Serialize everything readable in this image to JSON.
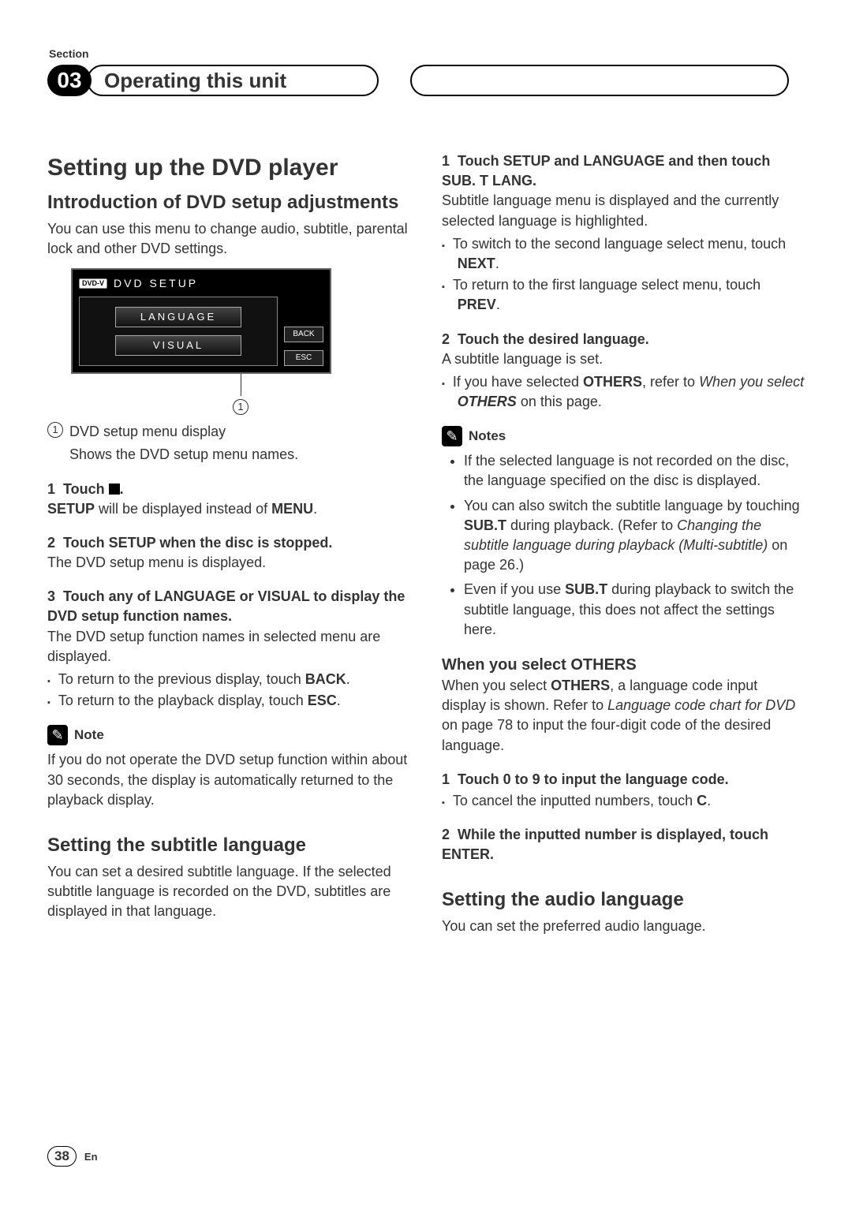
{
  "header": {
    "section_label": "Section",
    "section_number": "03",
    "title": "Operating this unit"
  },
  "left": {
    "h1": "Setting up the DVD player",
    "h2a": "Introduction of DVD setup adjustments",
    "intro": "You can use this menu to change audio, subtitle, parental lock and other DVD settings.",
    "fig": {
      "title": "DVD SETUP",
      "logo": "DVD-V",
      "btn_lang": "LANGUAGE",
      "btn_visual": "VISUAL",
      "btn_back": "BACK",
      "btn_esc": "ESC",
      "callout_num": "1"
    },
    "def_num": "1",
    "def_line1": "DVD setup menu display",
    "def_line2": "Shows the DVD setup menu names.",
    "step1_num": "1",
    "step1_pre": "Touch ",
    "step1_post": ".",
    "step1_body_a": "SETUP",
    "step1_body_b": " will be displayed instead of ",
    "step1_body_c": "MENU",
    "step1_body_d": ".",
    "step2_num": "2",
    "step2_title": "Touch SETUP when the disc is stopped.",
    "step2_body": "The DVD setup menu is displayed.",
    "step3_num": "3",
    "step3_title": "Touch any of LANGUAGE or VISUAL to display the DVD setup function names.",
    "step3_body": "The DVD setup function names in selected menu are displayed.",
    "step3_b1_a": "To return to the previous display, touch ",
    "step3_b1_b": "BACK",
    "step3_b1_c": ".",
    "step3_b2_a": "To return to the playback display, touch ",
    "step3_b2_b": "ESC",
    "step3_b2_c": ".",
    "note_label": "Note",
    "note_body": "If you do not operate the DVD setup function within about 30 seconds, the display is automatically returned to the playback display.",
    "h2b": "Setting the subtitle language",
    "h2b_body": "You can set a desired subtitle language. If the selected subtitle language is recorded on the DVD, subtitles are displayed in that language."
  },
  "right": {
    "r1_num": "1",
    "r1_title": "Touch SETUP and LANGUAGE and then touch SUB. T LANG.",
    "r1_body": "Subtitle language menu is displayed and the currently selected language is highlighted.",
    "r1_b1_a": "To switch to the second language select menu, touch ",
    "r1_b1_b": "NEXT",
    "r1_b1_c": ".",
    "r1_b2_a": "To return to the first language select menu, touch ",
    "r1_b2_b": "PREV",
    "r1_b2_c": ".",
    "r2_num": "2",
    "r2_title": "Touch the desired language.",
    "r2_body": "A subtitle language is set.",
    "r2_b1_a": "If you have selected ",
    "r2_b1_b": "OTHERS",
    "r2_b1_c": ", refer to ",
    "r2_b1_d": "When you select ",
    "r2_b1_e": "OTHERS",
    "r2_b1_f": " on this page.",
    "notes_label": "Notes",
    "note1": "If the selected language is not recorded on the disc, the language specified on the disc is displayed.",
    "note2_a": "You can also switch the subtitle language by touching ",
    "note2_b": "SUB.T",
    "note2_c": " during playback. (Refer to ",
    "note2_d": "Changing the subtitle language during playback (Multi-subtitle)",
    "note2_e": " on page 26.)",
    "note3_a": "Even if you use ",
    "note3_b": "SUB.T",
    "note3_c": " during playback to switch the subtitle language, this does not affect the settings here.",
    "h3_others": "When you select OTHERS",
    "others_a": "When you select ",
    "others_b": "OTHERS",
    "others_c": ", a language code input display is shown. Refer to ",
    "others_d": "Language code chart for DVD",
    "others_e": " on page 78 to input the four-digit code of the desired language.",
    "o1_num": "1",
    "o1_title": "Touch 0 to 9 to input the language code.",
    "o1_b1_a": "To cancel the inputted numbers, touch ",
    "o1_b1_b": "C",
    "o1_b1_c": ".",
    "o2_num": "2",
    "o2_title": "While the inputted number is displayed, touch ENTER.",
    "h2_audio": "Setting the audio language",
    "audio_body": "You can set the preferred audio language."
  },
  "footer": {
    "page": "38",
    "lang": "En"
  }
}
